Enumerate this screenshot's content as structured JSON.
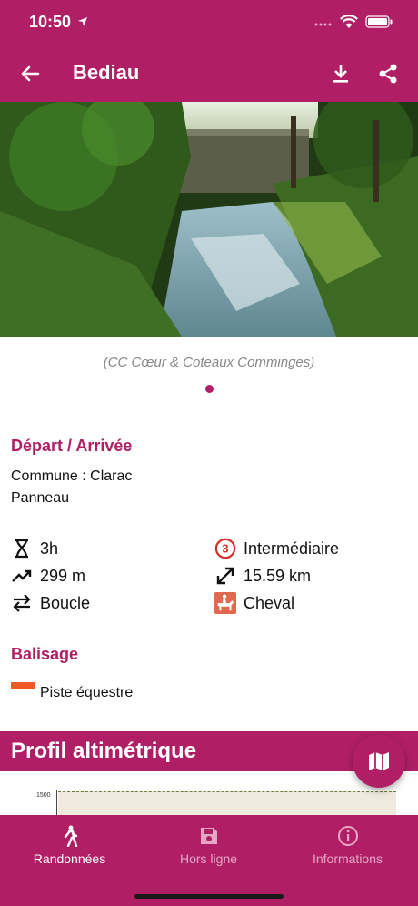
{
  "status_bar": {
    "time": "10:50"
  },
  "header": {
    "title": "Bediau"
  },
  "photo": {
    "caption": "(CC Cœur & Coteaux Comminges)"
  },
  "depart": {
    "title": "Départ / Arrivée",
    "line1": "Commune : Clarac",
    "line2": "Panneau"
  },
  "stats": {
    "duration": "3h",
    "elevation": "299 m",
    "loop": "Boucle",
    "difficulty": "Intermédiaire",
    "difficulty_level": "3",
    "distance": "15.59 km",
    "practice": "Cheval"
  },
  "balisage": {
    "title": "Balisage",
    "label": "Piste équestre"
  },
  "profil": {
    "title": "Profil altimétrique",
    "tick": "1500"
  },
  "nav": {
    "items": [
      {
        "label": "Randonnées"
      },
      {
        "label": "Hors ligne"
      },
      {
        "label": "Informations"
      }
    ]
  },
  "colors": {
    "brand": "#b01f66",
    "balisage": "#f05a22",
    "difficulty": "#d0312d"
  }
}
